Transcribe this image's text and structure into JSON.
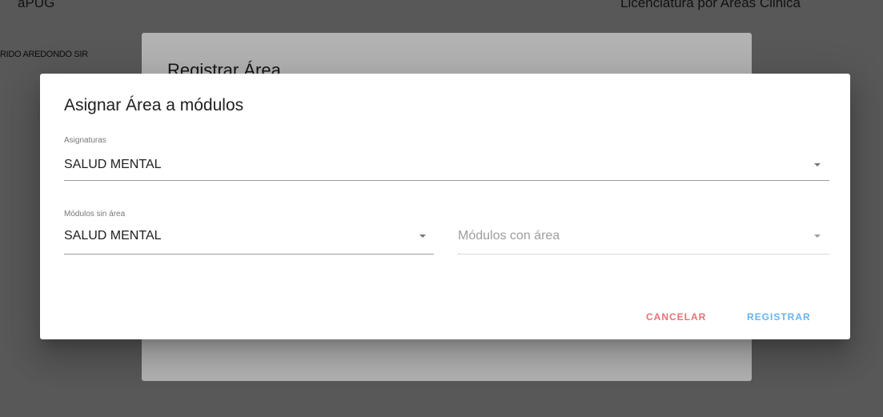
{
  "background": {
    "topbar_left": "aPUG",
    "topbar_right": "Licenciatura por Areas Clinica",
    "row_text": "RIDO AREDONDO SIR",
    "dialog_title": "Registrar Área"
  },
  "dialog": {
    "title": "Asignar Área a módulos",
    "asignaturas": {
      "label": "Asignaturas",
      "value": "SALUD MENTAL"
    },
    "modulos_sin_area": {
      "label": "Módulos sin área",
      "value": "SALUD MENTAL"
    },
    "modulos_con_area": {
      "placeholder": "Módulos con área"
    },
    "actions": {
      "cancel_label": "CANCELAR",
      "submit_label": "REGISTRAR"
    }
  },
  "colors": {
    "cancel": "#e57373",
    "primary": "#64b5f6"
  }
}
